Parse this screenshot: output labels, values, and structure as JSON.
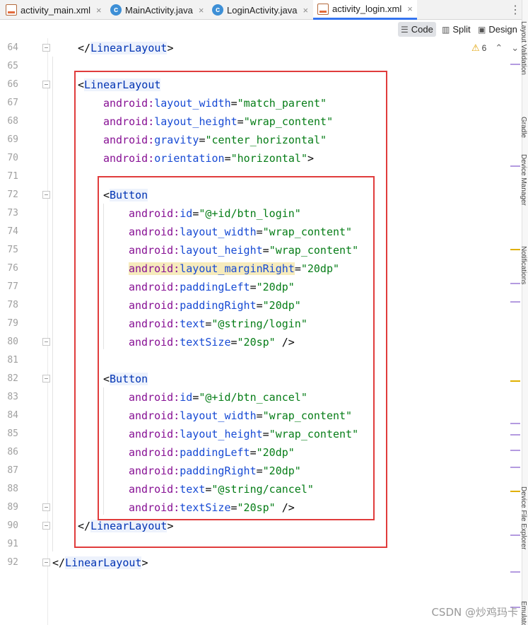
{
  "tabs": [
    {
      "label": "activity_main.xml",
      "icon": "xml-file-icon",
      "active": false
    },
    {
      "label": "MainActivity.java",
      "icon": "java-class-icon",
      "active": false
    },
    {
      "label": "LoginActivity.java",
      "icon": "java-class-icon",
      "active": false
    },
    {
      "label": "activity_login.xml",
      "icon": "xml-file-icon",
      "active": true
    }
  ],
  "view_modes": {
    "code": "Code",
    "split": "Split",
    "design": "Design"
  },
  "inspections": {
    "warning_count": "6"
  },
  "line_numbers": [
    "64",
    "65",
    "66",
    "67",
    "68",
    "69",
    "70",
    "71",
    "72",
    "73",
    "74",
    "75",
    "76",
    "77",
    "78",
    "79",
    "80",
    "81",
    "82",
    "83",
    "84",
    "85",
    "86",
    "87",
    "88",
    "89",
    "90",
    "91",
    "92"
  ],
  "code": {
    "l64": "LinearLayout",
    "l66_tag": "LinearLayout",
    "l67": {
      "attr": "layout_width",
      "val": "\"match_parent\""
    },
    "l68": {
      "attr": "layout_height",
      "val": "\"wrap_content\""
    },
    "l69": {
      "attr": "gravity",
      "val": "\"center_horizontal\""
    },
    "l70": {
      "attr": "orientation",
      "val": "\"horizontal\""
    },
    "l72_tag": "Button",
    "l73": {
      "attr": "id",
      "val": "\"@+id/btn_login\""
    },
    "l74": {
      "attr": "layout_width",
      "val": "\"wrap_content\""
    },
    "l75": {
      "attr": "layout_height",
      "val": "\"wrap_content\""
    },
    "l76": {
      "attr": "layout_marginRight",
      "val": "\"20dp\""
    },
    "l77": {
      "attr": "paddingLeft",
      "val": "\"20dp\""
    },
    "l78": {
      "attr": "paddingRight",
      "val": "\"20dp\""
    },
    "l79": {
      "attr": "text",
      "val": "\"@string/login\""
    },
    "l80": {
      "attr": "textSize",
      "val": "\"20sp\""
    },
    "l82_tag": "Button",
    "l83": {
      "attr": "id",
      "val": "\"@+id/btn_cancel\""
    },
    "l84": {
      "attr": "layout_width",
      "val": "\"wrap_content\""
    },
    "l85": {
      "attr": "layout_height",
      "val": "\"wrap_content\""
    },
    "l86": {
      "attr": "paddingLeft",
      "val": "\"20dp\""
    },
    "l87": {
      "attr": "paddingRight",
      "val": "\"20dp\""
    },
    "l88": {
      "attr": "text",
      "val": "\"@string/cancel\""
    },
    "l89": {
      "attr": "textSize",
      "val": "\"20sp\""
    },
    "l90": "LinearLayout",
    "l92": "LinearLayout",
    "ns": "android"
  },
  "side_panels": [
    "Layout Validation",
    "Gradle",
    "Device Manager",
    "Notifications",
    "Device File Explorer",
    "Emulator"
  ],
  "watermark": "CSDN @炒鸡玛卡",
  "colors": {
    "highlight_box": "#e03c3c",
    "active_tab_underline": "#3574f0"
  }
}
